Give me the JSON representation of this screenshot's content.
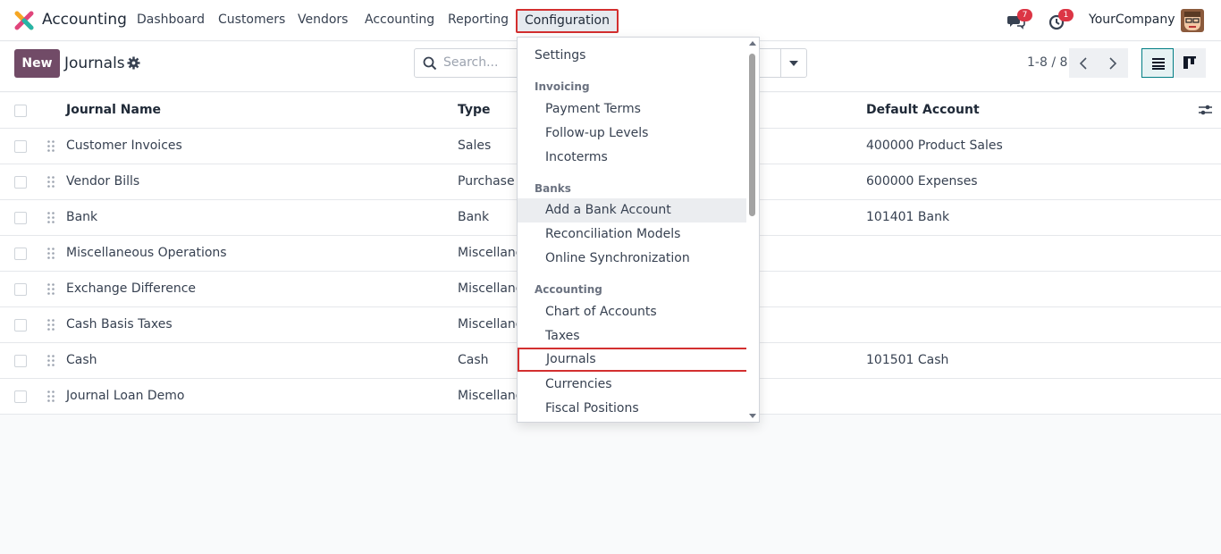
{
  "navbar": {
    "app_name": "Accounting",
    "menu": [
      "Dashboard",
      "Customers",
      "Vendors",
      "Accounting",
      "Reporting",
      "Configuration"
    ],
    "active_menu": "Configuration",
    "messages_count": "7",
    "activities_count": "1",
    "company": "YourCompany"
  },
  "control": {
    "new_label": "New",
    "title": "Journals",
    "search_placeholder": "Search...",
    "pager": "1-8 / 8"
  },
  "table": {
    "columns": [
      "Journal Name",
      "Type",
      "Default Account"
    ],
    "rows": [
      {
        "name": "Customer Invoices",
        "type": "Sales",
        "account": "400000 Product Sales"
      },
      {
        "name": "Vendor Bills",
        "type": "Purchase",
        "account": "600000 Expenses"
      },
      {
        "name": "Bank",
        "type": "Bank",
        "account": "101401 Bank"
      },
      {
        "name": "Miscellaneous Operations",
        "type": "Miscellane",
        "account": ""
      },
      {
        "name": "Exchange Difference",
        "type": "Miscellane",
        "account": ""
      },
      {
        "name": "Cash Basis Taxes",
        "type": "Miscellane",
        "account": ""
      },
      {
        "name": "Cash",
        "type": "Cash",
        "account": "101501 Cash"
      },
      {
        "name": "Journal Loan Demo",
        "type": "Miscellane",
        "account": ""
      }
    ]
  },
  "dropdown": {
    "settings": "Settings",
    "invoicing_header": "Invoicing",
    "invoicing_items": [
      "Payment Terms",
      "Follow-up Levels",
      "Incoterms"
    ],
    "banks_header": "Banks",
    "banks_items": [
      "Add a Bank Account",
      "Reconciliation Models",
      "Online Synchronization"
    ],
    "accounting_header": "Accounting",
    "accounting_items": [
      "Chart of Accounts",
      "Taxes",
      "Journals",
      "Currencies",
      "Fiscal Positions"
    ],
    "hovered_item": "Add a Bank Account",
    "highlighted_item": "Journals"
  },
  "colors": {
    "brand": "#714b67",
    "highlight_border": "#d32f2f",
    "badge": "#dc3545",
    "active_view": "#017e84"
  },
  "icons": [
    "app-logo-icon",
    "messages-icon",
    "activity-clock-icon",
    "gear-icon",
    "search-icon",
    "chevron-left-icon",
    "chevron-right-icon",
    "list-view-icon",
    "kanban-view-icon",
    "drag-handle-icon",
    "column-options-icon"
  ]
}
